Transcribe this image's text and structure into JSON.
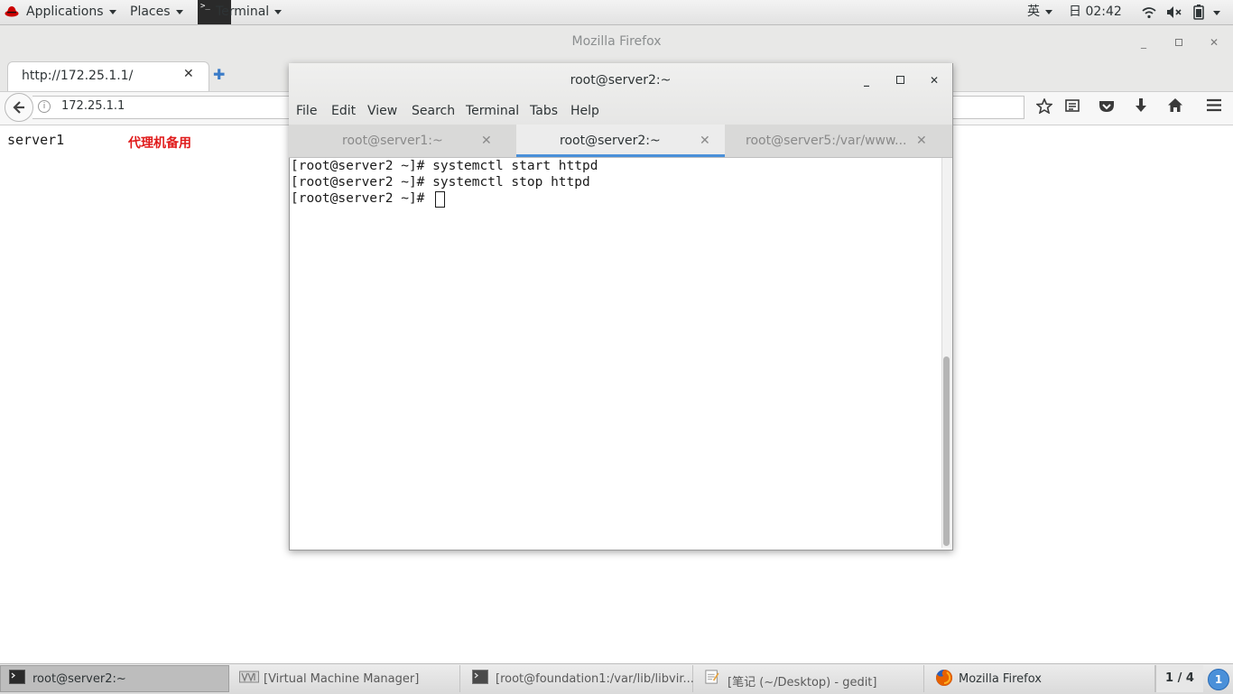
{
  "top_bar": {
    "applications": "Applications",
    "places": "Places",
    "active_app": "Terminal",
    "input_method": "英",
    "clock": "日 02:42"
  },
  "firefox": {
    "window_title": "Mozilla Firefox",
    "tab_title": "http://172.25.1.1/",
    "url": "172.25.1.1",
    "page": {
      "hostname_text": "server1",
      "note_text": "代理机备用"
    }
  },
  "terminal": {
    "window_title": "root@server2:~",
    "menu": [
      "File",
      "Edit",
      "View",
      "Search",
      "Terminal",
      "Tabs",
      "Help"
    ],
    "tabs": [
      {
        "label": "root@server1:~",
        "active": false
      },
      {
        "label": "root@server2:~",
        "active": true
      },
      {
        "label": "root@server5:/var/www...",
        "active": false
      }
    ],
    "lines": [
      "[root@server2 ~]# systemctl start httpd",
      "[root@server2 ~]# systemctl stop httpd",
      "[root@server2 ~]# "
    ]
  },
  "taskbar": {
    "items": [
      {
        "label": "root@server2:~",
        "active": true
      },
      {
        "label": "[Virtual Machine Manager]",
        "active": false
      },
      {
        "label": "[root@foundation1:/var/lib/libvir...",
        "active": false
      },
      {
        "label": "[笔记 (~/Desktop) - gedit]",
        "active": false
      },
      {
        "label": "Mozilla Firefox",
        "active": false
      }
    ],
    "workspace": "1 / 4",
    "notifications": "1"
  },
  "colors": {
    "accent": "#4a90d9",
    "note_red": "#e01b1b"
  }
}
